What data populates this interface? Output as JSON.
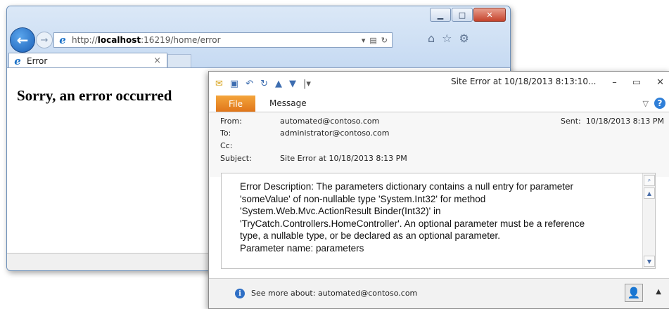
{
  "browser": {
    "url": {
      "prefix": "http://",
      "host": "localhost",
      "rest": ":16219/home/error"
    },
    "tab_title": "Error",
    "page_heading": "Sorry, an error occurred"
  },
  "mail": {
    "window_title": "Site Error at  10/18/2013 8:13:10...",
    "file_tab": "File",
    "message_tab": "Message",
    "labels": {
      "from": "From:",
      "to": "To:",
      "cc": "Cc:",
      "subject": "Subject:",
      "sent": "Sent:"
    },
    "from": "automated@contoso.com",
    "to": "administrator@contoso.com",
    "cc": "",
    "subject": "Site Error at  10/18/2013 8:13 PM",
    "sent": "10/18/2013 8:13 PM",
    "body_lines": [
      "Error Description: The parameters dictionary contains a null entry for parameter",
      "'someValue' of non-nullable type 'System.Int32' for method",
      "'System.Web.Mvc.ActionResult Binder(Int32)' in",
      "'TryCatch.Controllers.HomeController'. An optional parameter must be a reference",
      "type, a nullable type, or be declared as an optional parameter.",
      "Parameter name: parameters"
    ],
    "see_more": "See more about: automated@contoso.com"
  },
  "icons": {
    "back": "back-arrow-icon",
    "forward": "forward-arrow-icon",
    "home": "home-icon",
    "favorites": "star-icon",
    "tools": "gear-icon",
    "info": "info-icon"
  }
}
